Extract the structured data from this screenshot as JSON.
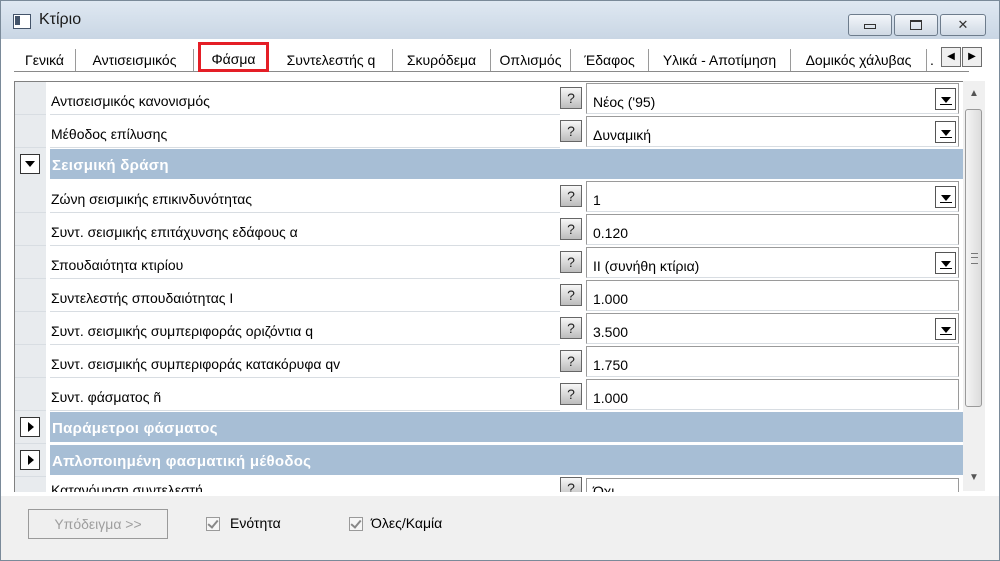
{
  "window": {
    "title": "Κτίριο"
  },
  "tabs": [
    {
      "label": "Γενικά"
    },
    {
      "label": "Αντισεισμικός"
    },
    {
      "label": "Φάσμα"
    },
    {
      "label": "Συντελεστής q"
    },
    {
      "label": "Σκυρόδεμα"
    },
    {
      "label": "Οπλισμός"
    },
    {
      "label": "Έδαφος"
    },
    {
      "label": "Υλικά - Αποτίμηση"
    },
    {
      "label": "Δομικός χάλυβας"
    },
    {
      "label": "."
    }
  ],
  "active_tab": "Φάσμα",
  "grid": {
    "help_glyph": "?",
    "rows": [
      {
        "label": "Αντισεισμικός κανονισμός",
        "value": "Νέος ('95)"
      },
      {
        "label": "Μέθοδος επίλυσης",
        "value": "Δυναμική"
      },
      {
        "section": "Σεισμική δράση"
      },
      {
        "label": "Ζώνη σεισμικής επικινδυνότητας",
        "value": "1"
      },
      {
        "label": "Συντ. σεισμικής επιτάχυνσης εδάφους α",
        "value": "0.120"
      },
      {
        "label": "Σπουδαιότητα κτιρίου",
        "value": "ΙΙ  (συνήθη κτίρια)"
      },
      {
        "label": "Συντελεστής  σπουδαιότητας Ι",
        "value": "1.000"
      },
      {
        "label": "Συντ. σεισμικής συμπεριφοράς οριζόντια q",
        "value": "3.500"
      },
      {
        "label": "Συντ. σεισμικής συμπεριφοράς κατακόρυφα qv",
        "value": "1.750"
      },
      {
        "label": "Συντ. φάσματος ñ",
        "value": "1.000"
      },
      {
        "section": "Παράμετροι φάσματος"
      },
      {
        "section": "Απλοποιημένη φασματική μέθοδος"
      },
      {
        "label": "Κατανόμηση συντελεστή ...",
        "value": "Όχι"
      }
    ]
  },
  "bottom": {
    "example_button": "Υπόδειγμα >>",
    "unit_checkbox": "Ενότητα",
    "all_none_checkbox": "Όλες/Καμία"
  }
}
